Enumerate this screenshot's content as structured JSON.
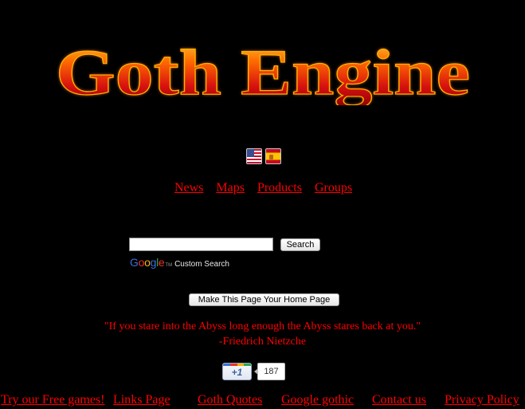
{
  "logo": {
    "text": "Goth Engine"
  },
  "languages": [
    {
      "name": "English",
      "icon": "us-flag-icon"
    },
    {
      "name": "Spanish",
      "icon": "spain-flag-icon"
    }
  ],
  "nav": {
    "items": [
      "News",
      "Maps",
      "Products",
      "Groups"
    ]
  },
  "search": {
    "value": "",
    "button_label": "Search",
    "brand": "Google",
    "brand_suffix": "Custom Search"
  },
  "homepage_button": "Make This Page Your Home Page",
  "quote": {
    "text": "\"If you stare into the Abyss long enough the Abyss stares back at you.\"",
    "author": "-Friedrich Nietzche"
  },
  "plusone": {
    "label": "+1",
    "count": "187"
  },
  "footer": {
    "links": [
      "Try our Free games!",
      "Links Page",
      "Goth Quotes",
      "Google gothic",
      "Contact us",
      "Privacy Policy"
    ]
  },
  "colors": {
    "background": "#000000",
    "link": "#ff0000",
    "logo_fill": "#e01010",
    "logo_flame": "#ff8a00"
  }
}
